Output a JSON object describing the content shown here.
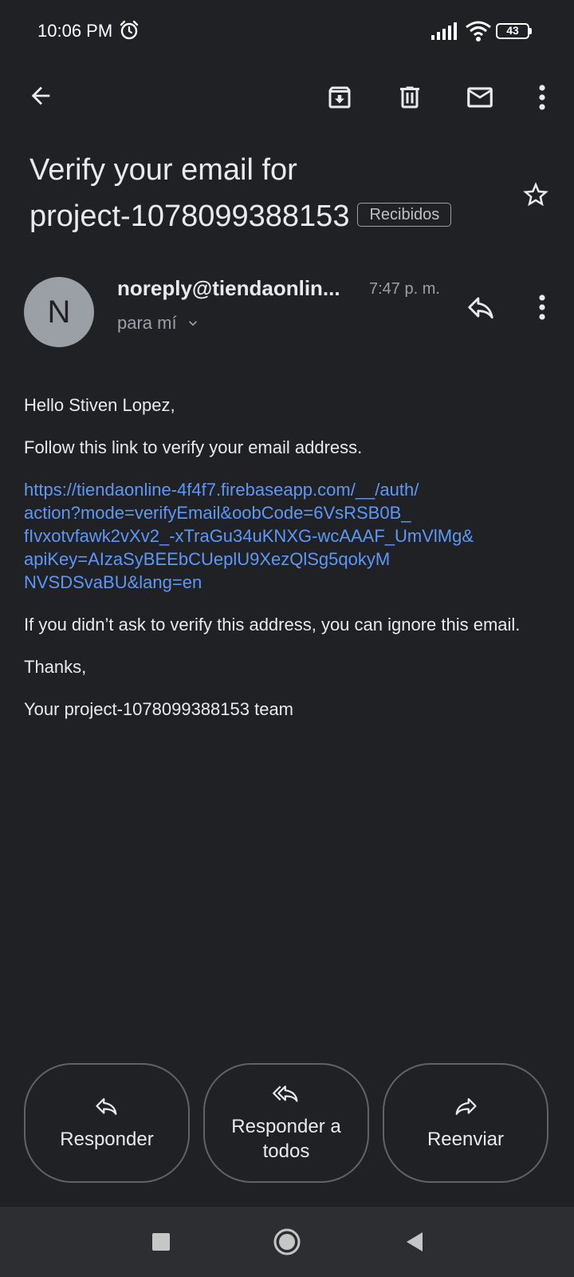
{
  "status_bar": {
    "time": "10:06 PM",
    "battery": "43"
  },
  "app_bar": {
    "icons": [
      "back-icon",
      "archive-icon",
      "delete-icon",
      "mark-unread-icon",
      "more-vert-icon"
    ]
  },
  "email": {
    "subject_line1": "Verify your email for",
    "subject_line2": "project-1078099388153",
    "label": "Recibidos",
    "sender_initial": "N",
    "sender": "noreply@tiendaonlin...",
    "time": "7:47 p. m.",
    "recipient": "para mí",
    "body": {
      "greeting": "Hello Stiven Lopez,",
      "instruction": "Follow this link to verify your email address.",
      "link": "https://tiendaonline-4f4f7.firebaseapp.com/__/auth/action?mode=verifyEmail&oobCode=6VsRSB0B_fIvxotvfawk2vXv2_-xTraGu34uKNXG-wcAAAF_UmVlMg&apiKey=AIzaSyBEEbCUeplU9XezQlSg5qokyMNVSDSvaBU&lang=en",
      "link_lines": [
        "https://tiendaonline-4f4f7.firebaseapp.com/__/auth/",
        "action?mode=verifyEmail&oobCode=6VsRSB0B_",
        "fIvxotvfawk2vXv2_-xTraGu34uKNXG-wcAAAF_UmVlMg&",
        "apiKey=AIzaSyBEEbCUeplU9XezQlSg5qokyM",
        "NVSDSvaBU&lang=en"
      ],
      "disclaimer": "If you didn’t ask to verify this address, you can ignore this email.",
      "thanks": "Thanks,",
      "signature": "Your project-1078099388153 team"
    }
  },
  "actions": {
    "reply": "Responder",
    "reply_all_line1": "Responder a",
    "reply_all_line2": "todos",
    "forward": "Reenviar"
  },
  "colors": {
    "background": "#202124",
    "link": "#5e97f6",
    "nav_bar": "#2d2e31"
  }
}
